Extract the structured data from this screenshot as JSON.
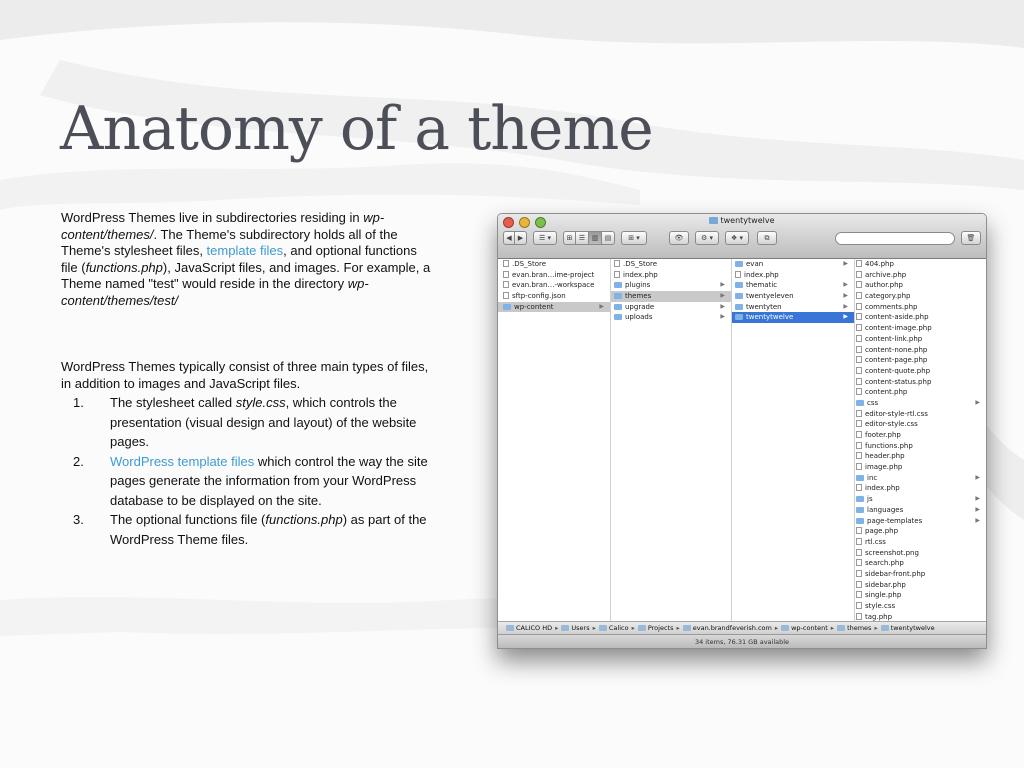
{
  "slide": {
    "title": "Anatomy of a theme",
    "p1_a": "WordPress Themes live in subdirectories residing in ",
    "p1_path1": "wp-content/themes/",
    "p1_b": ". The Theme's subdirectory holds all of the Theme's stylesheet files, ",
    "p1_link": "template files",
    "p1_c": ", and optional functions file (",
    "p1_func": "functions.php",
    "p1_d": "), JavaScript files, and images. For example, a Theme named \"test\" would reside in the directory ",
    "p1_path2": "wp-content/themes/test/",
    "p2": "WordPress Themes typically consist of three main types of files, in addition to images and JavaScript files.",
    "list": [
      {
        "num": "1.",
        "a": "The stylesheet called ",
        "em": "style.css",
        "b": ", which controls the presentation (visual design and layout) of the website pages."
      },
      {
        "num": "2.",
        "link": "WordPress template files",
        "b": " which control the way the site pages generate the information from your WordPress database to be displayed on the site."
      },
      {
        "num": "3.",
        "a": "The optional functions file (",
        "em": "functions.php",
        "b": ") as part of the WordPress Theme files."
      }
    ],
    "link_color": "#3d9bd3",
    "title_color": "#4c4e58"
  },
  "finder": {
    "window_title": "twentytwelve",
    "search_placeholder": "",
    "toolbar": {
      "back": "◀",
      "forward": "▶",
      "path_menu": "☰ ▾",
      "view_icon": "⊞",
      "view_list": "☰",
      "view_column": "▥",
      "view_cover": "▤",
      "arrange": "⊞ ▾",
      "quicklook": "👁",
      "action": "⚙ ▾",
      "dropbox": "❖ ▾",
      "new_folder": "⧉",
      "trash": "🗑"
    },
    "columns": [
      {
        "items": [
          {
            "name": ".DS_Store",
            "icon": "file"
          },
          {
            "name": "evan.bran…ime-project",
            "icon": "file"
          },
          {
            "name": "evan.bran…-workspace",
            "icon": "file"
          },
          {
            "name": "sftp-config.json",
            "icon": "file"
          },
          {
            "name": "wp-content",
            "icon": "folder",
            "arrow": "▶",
            "state": "selected-gray"
          }
        ]
      },
      {
        "items": [
          {
            "name": ".DS_Store",
            "icon": "file"
          },
          {
            "name": "index.php",
            "icon": "file"
          },
          {
            "name": "plugins",
            "icon": "folder",
            "arrow": "▶"
          },
          {
            "name": "themes",
            "icon": "folder",
            "arrow": "▶",
            "state": "selected-gray"
          },
          {
            "name": "upgrade",
            "icon": "folder",
            "arrow": "▶"
          },
          {
            "name": "uploads",
            "icon": "folder",
            "arrow": "▶"
          }
        ]
      },
      {
        "items": [
          {
            "name": "evan",
            "icon": "folder",
            "arrow": "▶"
          },
          {
            "name": "index.php",
            "icon": "file"
          },
          {
            "name": "thematic",
            "icon": "folder",
            "arrow": "▶"
          },
          {
            "name": "twentyeleven",
            "icon": "folder",
            "arrow": "▶"
          },
          {
            "name": "twentyten",
            "icon": "folder",
            "arrow": "▶"
          },
          {
            "name": "twentytwelve",
            "icon": "folder",
            "arrow": "▶",
            "state": "selected-blue"
          }
        ]
      },
      {
        "items": [
          {
            "name": "404.php",
            "icon": "file"
          },
          {
            "name": "archive.php",
            "icon": "file"
          },
          {
            "name": "author.php",
            "icon": "file"
          },
          {
            "name": "category.php",
            "icon": "file"
          },
          {
            "name": "comments.php",
            "icon": "file"
          },
          {
            "name": "content-aside.php",
            "icon": "file"
          },
          {
            "name": "content-image.php",
            "icon": "file"
          },
          {
            "name": "content-link.php",
            "icon": "file"
          },
          {
            "name": "content-none.php",
            "icon": "file"
          },
          {
            "name": "content-page.php",
            "icon": "file"
          },
          {
            "name": "content-quote.php",
            "icon": "file"
          },
          {
            "name": "content-status.php",
            "icon": "file"
          },
          {
            "name": "content.php",
            "icon": "file"
          },
          {
            "name": "css",
            "icon": "folder",
            "arrow": "▶"
          },
          {
            "name": "editor-style-rtl.css",
            "icon": "file"
          },
          {
            "name": "editor-style.css",
            "icon": "file"
          },
          {
            "name": "footer.php",
            "icon": "file"
          },
          {
            "name": "functions.php",
            "icon": "file"
          },
          {
            "name": "header.php",
            "icon": "file"
          },
          {
            "name": "image.php",
            "icon": "file"
          },
          {
            "name": "inc",
            "icon": "folder",
            "arrow": "▶"
          },
          {
            "name": "index.php",
            "icon": "file"
          },
          {
            "name": "js",
            "icon": "folder",
            "arrow": "▶"
          },
          {
            "name": "languages",
            "icon": "folder",
            "arrow": "▶"
          },
          {
            "name": "page-templates",
            "icon": "folder",
            "arrow": "▶"
          },
          {
            "name": "page.php",
            "icon": "file"
          },
          {
            "name": "rtl.css",
            "icon": "file"
          },
          {
            "name": "screenshot.png",
            "icon": "file"
          },
          {
            "name": "search.php",
            "icon": "file"
          },
          {
            "name": "sidebar-front.php",
            "icon": "file"
          },
          {
            "name": "sidebar.php",
            "icon": "file"
          },
          {
            "name": "single.php",
            "icon": "file"
          },
          {
            "name": "style.css",
            "icon": "file"
          },
          {
            "name": "tag.php",
            "icon": "file"
          }
        ]
      }
    ],
    "path": [
      "CALICO HD",
      "Users",
      "Calico",
      "Projects",
      "evan.brandfeverish.com",
      "wp-content",
      "themes",
      "twentytwelve"
    ],
    "status": "34 items, 76.31 GB available",
    "selection_color": "#3875d7"
  }
}
